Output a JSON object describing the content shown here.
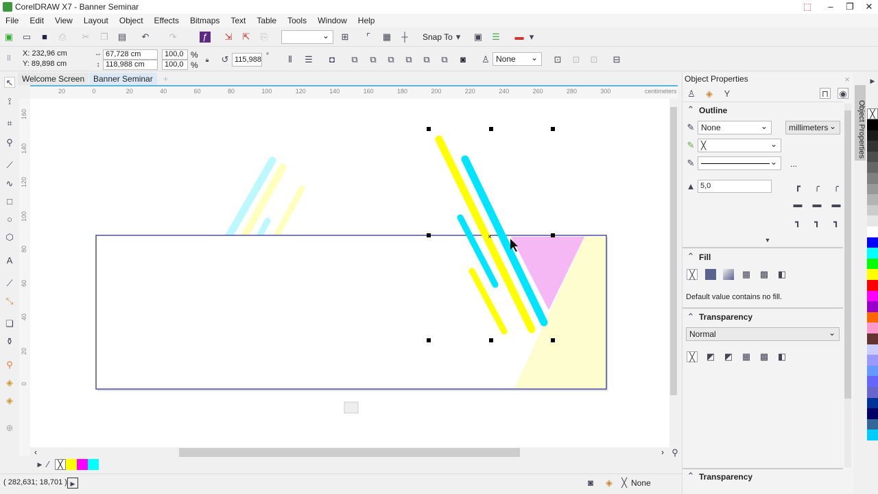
{
  "window": {
    "title": "CorelDRAW X7 - Banner Seminar"
  },
  "menu": [
    "File",
    "Edit",
    "View",
    "Layout",
    "Object",
    "Effects",
    "Bitmaps",
    "Text",
    "Table",
    "Tools",
    "Window",
    "Help"
  ],
  "toolbar": {
    "snap_to": "Snap To",
    "zoom_value": ""
  },
  "property_bar": {
    "x": "X: 232,96 cm",
    "y": "Y: 89,898 cm",
    "width": "67,728 cm",
    "height": "118,988 cm",
    "scale_x": "100,0",
    "scale_y": "100,0",
    "pct": "%",
    "rotation": "115,988",
    "degree": "°",
    "outline": "None"
  },
  "tabs": [
    "Welcome Screen",
    "Banner Seminar"
  ],
  "ruler": {
    "unit": "centimeters",
    "h_labels": [
      "20",
      "0",
      "20",
      "40",
      "60",
      "80",
      "100",
      "120",
      "140",
      "160",
      "180",
      "200",
      "220",
      "240",
      "260",
      "280",
      "300"
    ],
    "v_labels": [
      "160",
      "140",
      "120",
      "100",
      "80",
      "60",
      "40",
      "20",
      "0"
    ]
  },
  "panel": {
    "title": "Object Properties",
    "side_tab": "Object Properties",
    "outline": {
      "title": "Outline",
      "width": "None",
      "units": "millimeters",
      "more": "...",
      "miter": "5,0"
    },
    "fill": {
      "title": "Fill",
      "note": "Default value contains no fill."
    },
    "transparency": {
      "title": "Transparency",
      "mode": "Normal"
    },
    "transparency2": {
      "title": "Transparency"
    }
  },
  "document_palette": {
    "colors": [
      "#ffff00",
      "#ff00ff",
      "#00ffff"
    ]
  },
  "palette": {
    "colors": [
      "#000000",
      "#1a1a1a",
      "#333333",
      "#4d4d4d",
      "#666666",
      "#808080",
      "#999999",
      "#b3b3b3",
      "#cccccc",
      "#e6e6e6",
      "#ffffff",
      "#0000ff",
      "#00ffff",
      "#00ff00",
      "#ffff00",
      "#ff0000",
      "#ff00ff",
      "#9900cc",
      "#ff6600",
      "#ff99cc",
      "#663333",
      "#ccccff",
      "#9999ff",
      "#6699ff",
      "#6666ff",
      "#6666cc",
      "#003399",
      "#000066",
      "#336699",
      "#00ccff"
    ]
  },
  "status": {
    "coords": "( 282,631; 18,701 )",
    "fill": "None"
  },
  "artwork": {
    "yellow": "#ffff00",
    "cyan": "#00e5ff",
    "pink": "#f5b8f5",
    "pale_yellow": "#fdfdd0",
    "page_border": "#4b4f9e"
  }
}
